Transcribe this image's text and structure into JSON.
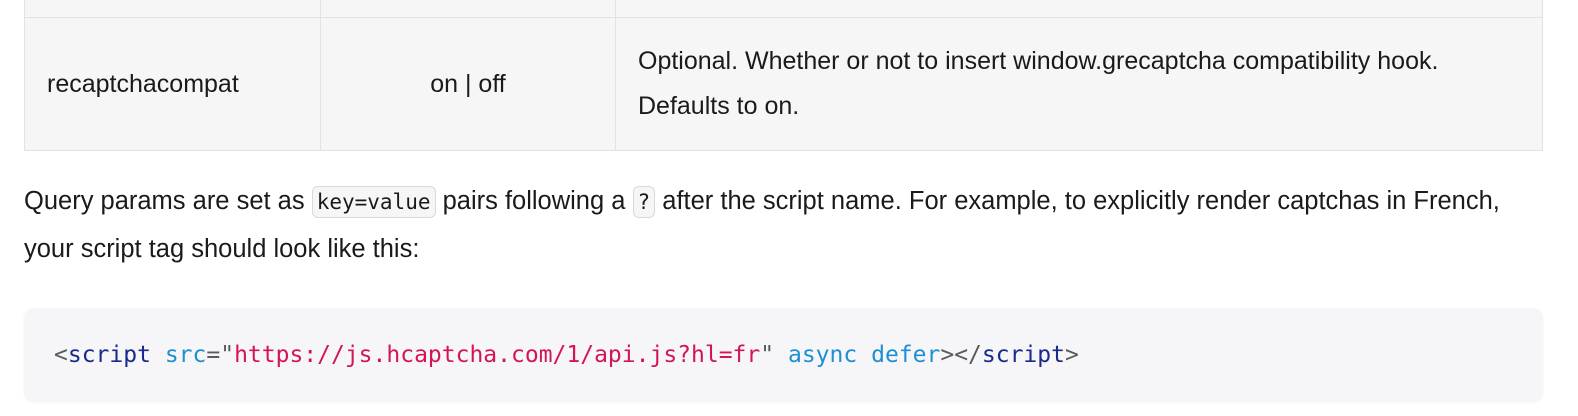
{
  "table": {
    "rows": [
      {
        "param": "recaptchacompat",
        "values": "on | off",
        "description": "Optional. Whether or not to insert window.grecaptcha compatibility hook. Defaults to on."
      }
    ]
  },
  "paragraph": {
    "part1": "Query params are set as ",
    "code1": "key=value",
    "part2": " pairs following a ",
    "code2": "?",
    "part3": " after the script name. For example, to explicitly render captchas in French, your script tag should look like this:"
  },
  "code_block": {
    "lt": "<",
    "tag_open": "script",
    "space1": " ",
    "attr_src": "src",
    "eq_quote": "=\"",
    "src_value": "https://js.hcaptcha.com/1/api.js?hl=fr",
    "close_quote": "\"",
    "space2": " ",
    "attr_async": "async",
    "space3": " ",
    "attr_defer": "defer",
    "gt_lt_slash": "></",
    "tag_close": "script",
    "gt": ">"
  },
  "colors": {
    "tag": "#1a2a8a",
    "attribute": "#1e8fd0",
    "string": "#d4145a",
    "table_background": "#f6f6f6"
  }
}
